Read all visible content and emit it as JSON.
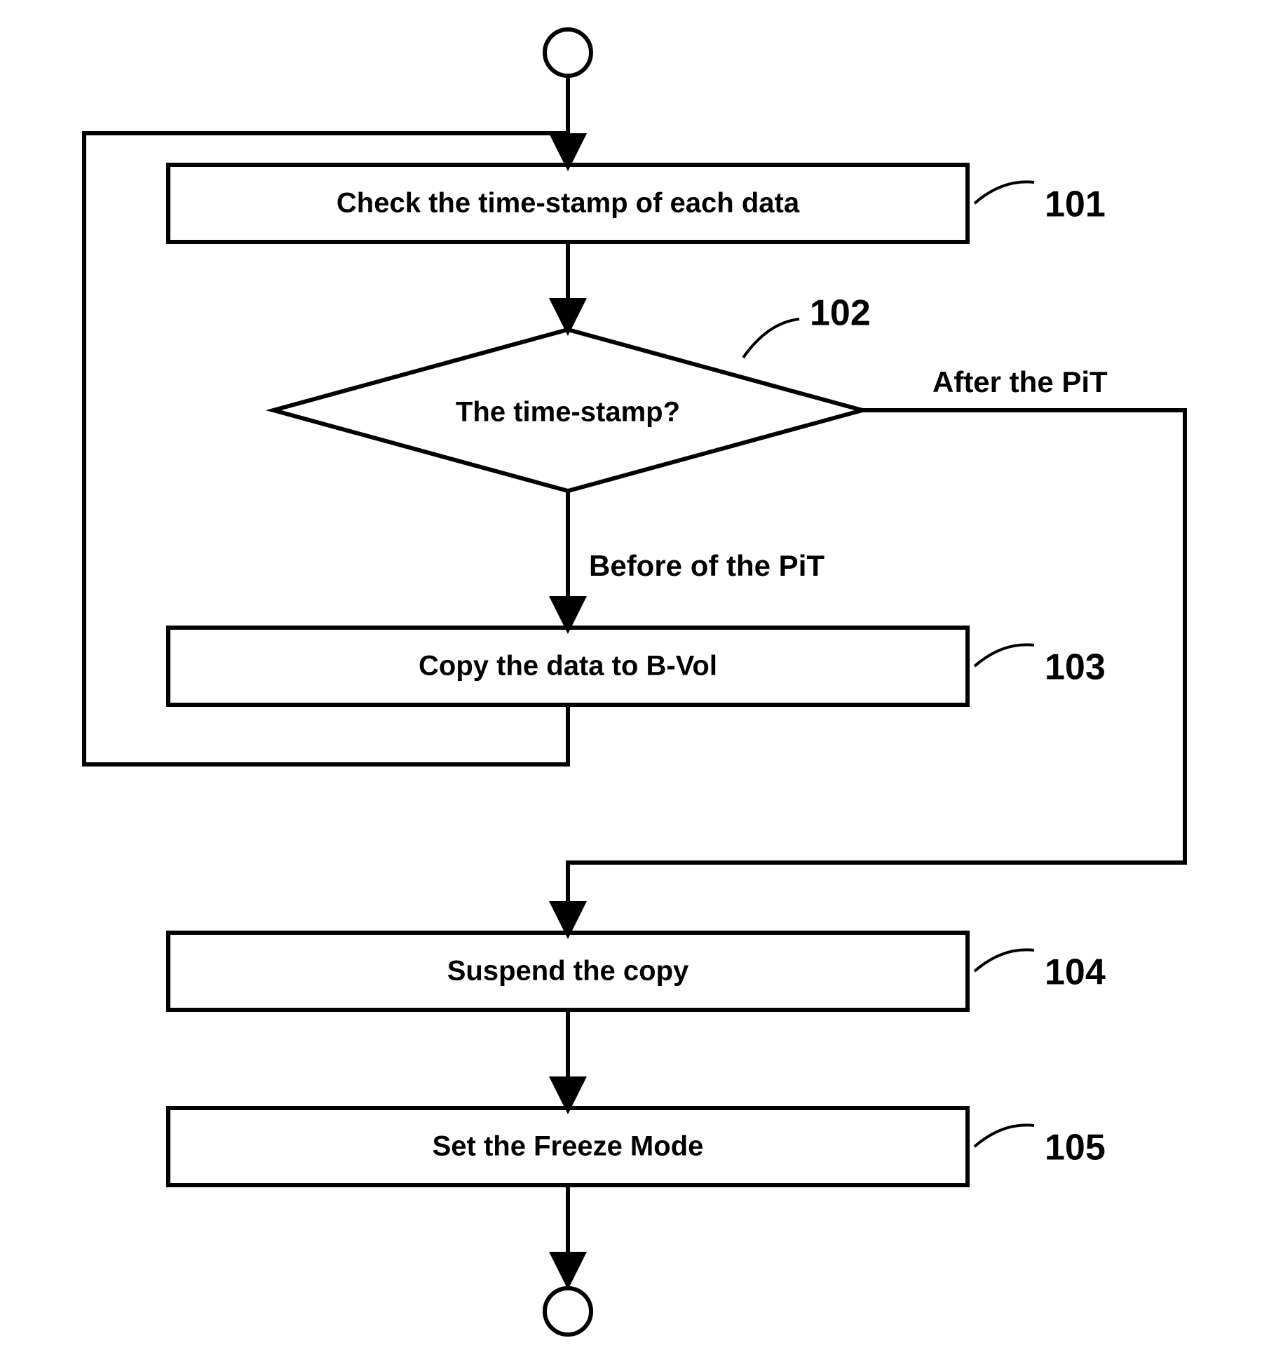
{
  "steps": {
    "s101": {
      "text": "Check the time-stamp of each data",
      "ref": "101"
    },
    "s102": {
      "text": "The time-stamp?",
      "ref": "102"
    },
    "s103": {
      "text": "Copy the data to B-Vol",
      "ref": "103"
    },
    "s104": {
      "text": "Suspend the copy",
      "ref": "104"
    },
    "s105": {
      "text": "Set the Freeze Mode",
      "ref": "105"
    }
  },
  "branches": {
    "before": "Before of the PiT",
    "after": "After the PiT"
  }
}
